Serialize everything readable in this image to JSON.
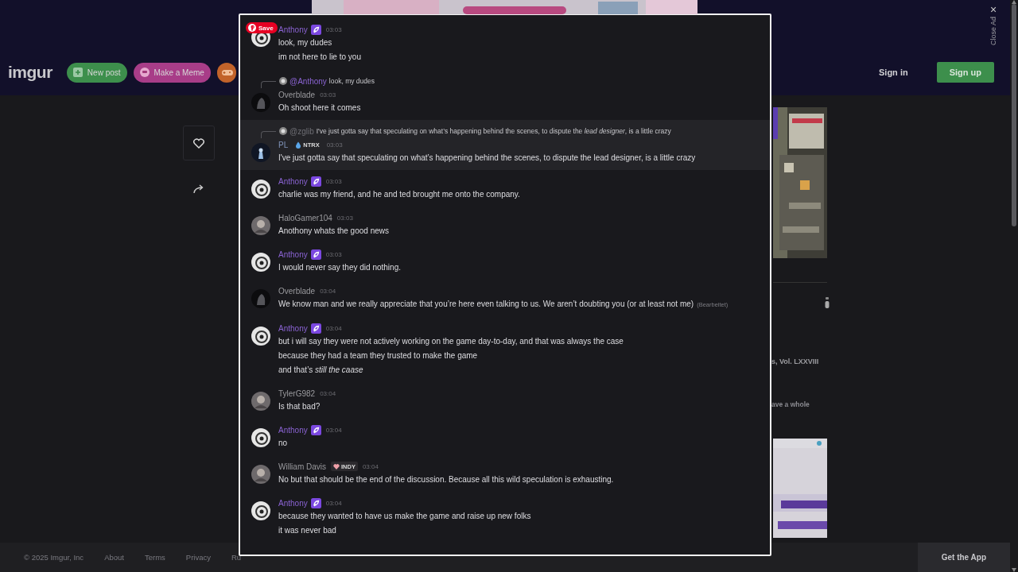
{
  "header": {
    "logo": "imgur",
    "buttons": [
      {
        "kind": "new-post",
        "label": "New post"
      },
      {
        "kind": "meme",
        "label": "Make a Meme"
      },
      {
        "kind": "games"
      }
    ],
    "sign_in": "Sign in",
    "sign_up": "Sign up"
  },
  "close_ad": {
    "close": "×",
    "label": "Close Ad"
  },
  "sidebar": {
    "texts": [
      "s, Vol. LXXVIII",
      "ave a whole"
    ]
  },
  "chat": {
    "save_button": "Save",
    "messages": [
      {
        "author": "Anthony",
        "color": "#8a63d2",
        "badge": {
          "kind": "verified"
        },
        "time": "03:03",
        "highlighted": false,
        "lines": [
          "look, my dudes",
          "im not here to lie to you"
        ]
      },
      {
        "author": "Overblade",
        "color": "#9a9a9e",
        "time": "03:03",
        "highlighted": false,
        "reply": {
          "mention": "@Anthony",
          "color": "#8a63d2",
          "text": "look, my dudes"
        },
        "lines": [
          "Oh shoot here it comes"
        ]
      },
      {
        "author": "PL",
        "color": "#7f93b8",
        "badge": {
          "kind": "booster",
          "label": "NTRX"
        },
        "time": "03:03",
        "highlighted": true,
        "reply": {
          "mention": "@zglib",
          "color": "#6e6e74",
          "text": "I've just gotta say that speculating on what’s happening behind the scenes, to dispute the *lead designer*, is a little crazy"
        },
        "lines": [
          "I've just gotta say that speculating on what’s happening behind the scenes, to dispute the lead designer, is a little crazy"
        ]
      },
      {
        "author": "Anthony",
        "color": "#8a63d2",
        "badge": {
          "kind": "verified"
        },
        "time": "03:03",
        "highlighted": false,
        "lines": [
          "charlie was my friend, and he and ted brought me onto the company."
        ]
      },
      {
        "author": "HaloGamer104",
        "color": "#9a9a9e",
        "time": "03:03",
        "highlighted": false,
        "lines": [
          "Anothony whats the good news"
        ]
      },
      {
        "author": "Anthony",
        "color": "#8a63d2",
        "badge": {
          "kind": "verified"
        },
        "time": "03:03",
        "highlighted": false,
        "lines": [
          "I would never say they did nothing."
        ]
      },
      {
        "author": "Overblade",
        "color": "#9a9a9e",
        "time": "03:04",
        "highlighted": false,
        "lines": [
          "We know man and we really appreciate that you’re here even talking to us. We aren’t doubting you (or at least not me)"
        ],
        "edited_note": "(Bearbeitet)"
      },
      {
        "author": "Anthony",
        "color": "#8a63d2",
        "badge": {
          "kind": "verified"
        },
        "time": "03:04",
        "highlighted": false,
        "lines": [
          "but i will say they were not actively working on the game day-to-day, and that was always the case",
          "because they had a team they trusted to make the game",
          "and that’s *still the caase*"
        ]
      },
      {
        "author": "TylerG982",
        "color": "#9a9a9e",
        "time": "03:04",
        "highlighted": false,
        "lines": [
          "Is that bad?"
        ]
      },
      {
        "author": "Anthony",
        "color": "#8a63d2",
        "badge": {
          "kind": "verified"
        },
        "time": "03:04",
        "highlighted": false,
        "lines": [
          "no"
        ]
      },
      {
        "author": "William Davis",
        "color": "#9a9a9e",
        "badge": {
          "kind": "supporter",
          "label": "INDY"
        },
        "time": "03:04",
        "highlighted": false,
        "lines": [
          "No but that should be the end of the discussion. Because all this wild speculation is exhausting."
        ]
      },
      {
        "author": "Anthony",
        "color": "#8a63d2",
        "badge": {
          "kind": "verified"
        },
        "time": "03:04",
        "highlighted": false,
        "lines": [
          "because they wanted to have us make the game and raise up new folks",
          "it was never bad"
        ]
      }
    ]
  },
  "footer": {
    "copyright": "© 2025 Imgur, Inc",
    "links": [
      "About",
      "Terms",
      "Privacy",
      "Ru"
    ],
    "app_button": "Get the App"
  }
}
